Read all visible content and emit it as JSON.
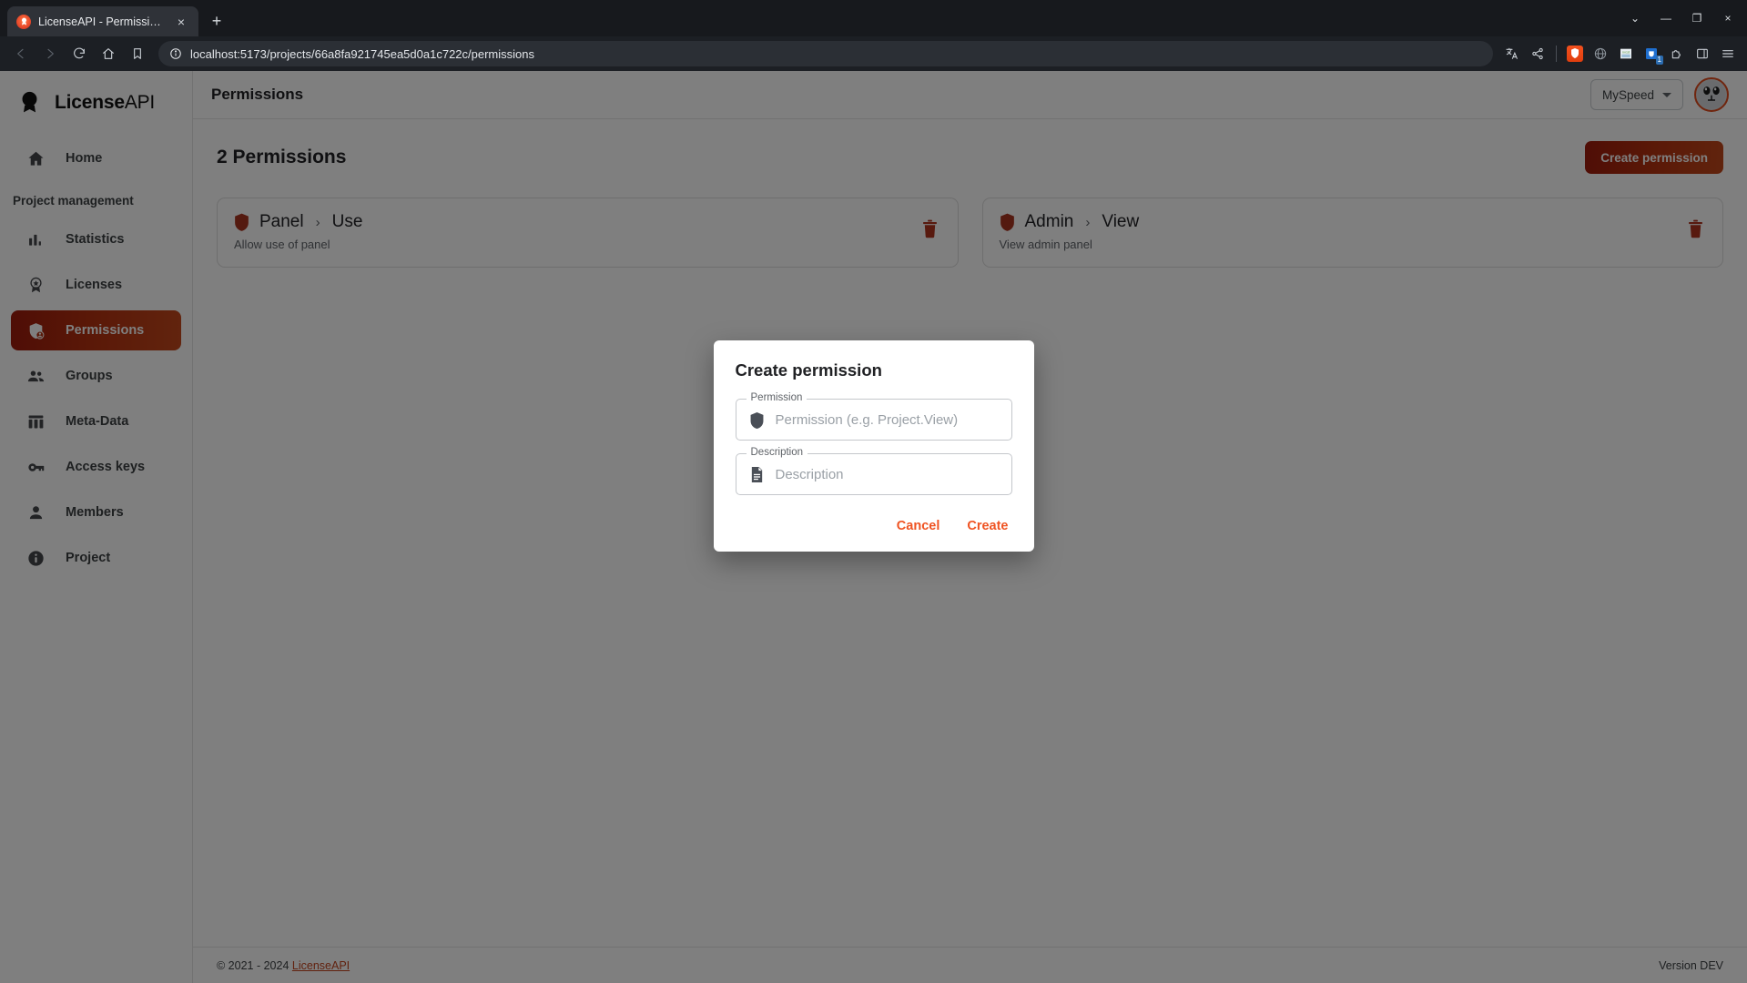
{
  "browser": {
    "tab": {
      "title": "LicenseAPI - Permissions",
      "favicon": "shield-award-icon",
      "close": "×"
    },
    "new_tab_label": "+",
    "window_controls": {
      "minimize": "—",
      "maximize": "❐",
      "close": "×",
      "list": "⌄"
    },
    "nav": {
      "back": "back-arrow-icon",
      "forward": "forward-arrow-icon",
      "reload": "reload-icon",
      "home": "home-icon",
      "bookmark": "bookmark-icon"
    },
    "url": "localhost:5173/projects/66a8fa921745ea5d0a1c722c/permissions",
    "toolbar_icons": [
      "translate-icon",
      "share-icon",
      "brave-shields-icon",
      "globe-extension-icon",
      "nvidia-extension-icon",
      "pocket-extension-icon",
      "puzzle-extensions-icon",
      "sidebar-panel-icon",
      "hamburger-menu-icon"
    ],
    "extension_badge": "1"
  },
  "sidebar": {
    "brand": {
      "bold": "License",
      "light": "API"
    },
    "items": [
      {
        "label": "Home",
        "icon": "home-icon",
        "active": false
      },
      {
        "label": "Statistics",
        "icon": "bar-chart-icon",
        "active": false
      },
      {
        "label": "Licenses",
        "icon": "license-badge-icon",
        "active": false
      },
      {
        "label": "Permissions",
        "icon": "shield-person-icon",
        "active": true
      },
      {
        "label": "Groups",
        "icon": "groups-icon",
        "active": false
      },
      {
        "label": "Meta-Data",
        "icon": "table-columns-icon",
        "active": false
      },
      {
        "label": "Access keys",
        "icon": "key-icon",
        "active": false
      },
      {
        "label": "Members",
        "icon": "person-icon",
        "active": false
      },
      {
        "label": "Project",
        "icon": "info-icon",
        "active": false
      }
    ],
    "section_label": "Project management"
  },
  "topbar": {
    "title": "Permissions",
    "speed_selector": "MySpeed",
    "avatar": "user-avatar"
  },
  "content": {
    "count_title": "2 Permissions",
    "create_button": "Create permission",
    "permissions": [
      {
        "resource": "Panel",
        "separator": "›",
        "action": "Use",
        "description": "Allow use of panel",
        "delete": "delete-icon"
      },
      {
        "resource": "Admin",
        "separator": "›",
        "action": "View",
        "description": "View admin panel",
        "delete": "delete-icon"
      }
    ]
  },
  "footer": {
    "copyright": "© 2021 - 2024",
    "link": "LicenseAPI",
    "version": "Version DEV"
  },
  "modal": {
    "title": "Create permission",
    "permission_field": {
      "legend": "Permission",
      "placeholder": "Permission (e.g. Project.View)",
      "value": "",
      "icon": "shield-icon"
    },
    "description_field": {
      "legend": "Description",
      "placeholder": "Description",
      "value": "",
      "icon": "document-icon"
    },
    "cancel_label": "Cancel",
    "create_label": "Create"
  },
  "colors": {
    "accent_red": "#c2431c",
    "accent_orange": "#ef5322",
    "shield_red": "#a93420",
    "sidebar_active_start": "#9e1b0c",
    "sidebar_active_end": "#c4481c"
  }
}
